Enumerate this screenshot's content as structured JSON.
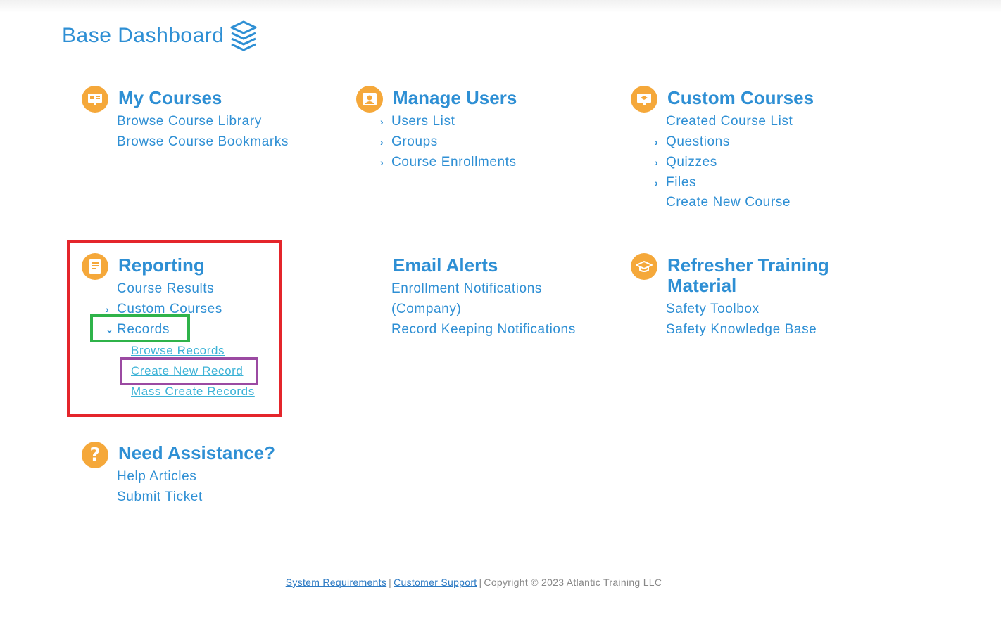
{
  "header": {
    "title": "Base Dashboard",
    "icon": "stack-layers-icon"
  },
  "colors": {
    "accent": "#2e8fd4",
    "icon_bg": "#f5a83a",
    "sublink": "#3cb2d6",
    "highlight_red": "#e4252b",
    "highlight_green": "#2fb34a",
    "highlight_purple": "#9b4aa2"
  },
  "my_courses": {
    "title": "My Courses",
    "links": [
      "Browse Course Library",
      "Browse Course Bookmarks"
    ]
  },
  "manage_users": {
    "title": "Manage Users",
    "links": [
      "Users List",
      "Groups",
      "Course Enrollments"
    ]
  },
  "custom_courses": {
    "title": "Custom Courses",
    "links": [
      "Created Course List",
      "Questions",
      "Quizzes",
      "Files",
      "Create New Course"
    ]
  },
  "reporting": {
    "title": "Reporting",
    "links": [
      "Course Results",
      "Custom Courses",
      "Records"
    ],
    "records_sub": [
      "Browse Records",
      "Create New Record",
      "Mass Create Records"
    ]
  },
  "email_alerts": {
    "title": "Email Alerts",
    "links": [
      "Enrollment Notifications",
      "(Company)",
      "Record Keeping Notifications"
    ]
  },
  "refresher": {
    "title_line1": "Refresher Training",
    "title_line2": "Material",
    "links": [
      "Safety Toolbox",
      "Safety Knowledge Base"
    ]
  },
  "assistance": {
    "title": "Need Assistance?",
    "links": [
      "Help Articles",
      "Submit Ticket"
    ]
  },
  "footer": {
    "system_requirements": "System Requirements",
    "separator": "|",
    "customer_support": "Customer Support",
    "copyright": "Copyright © 2023 Atlantic Training LLC"
  }
}
